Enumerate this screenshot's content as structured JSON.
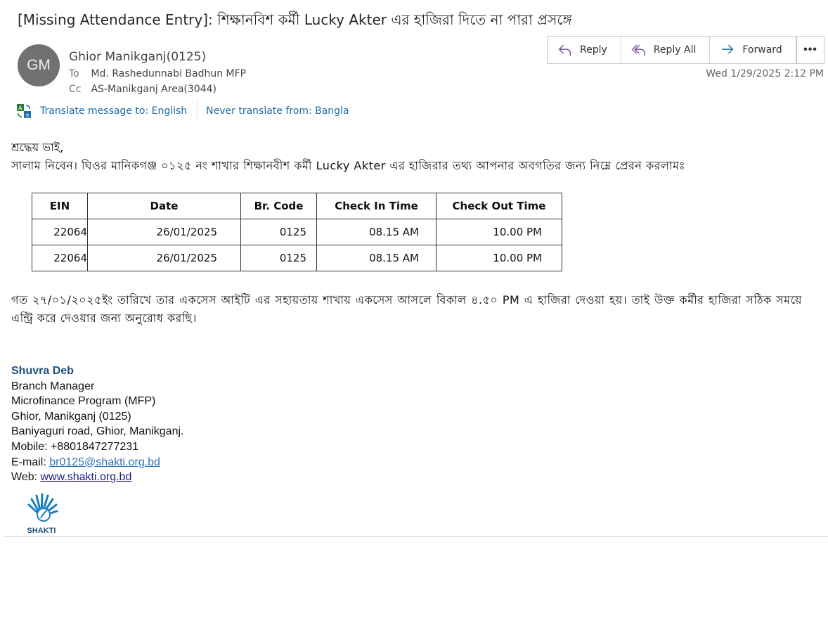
{
  "subject": "[Missing Attendance Entry]: শিক্ষানবিশ কর্মী Lucky Akter  এর হাজিরা দিতে না পারা প্রসঙ্গে",
  "avatar_initials": "GM",
  "sender": "Ghior Manikganj(0125)",
  "to_label": "To",
  "to_value": "Md. Rashedunnabi Badhun MFP",
  "cc_label": "Cc",
  "cc_value": "AS-Manikganj Area(3044)",
  "date": "Wed 1/29/2025 2:12 PM",
  "actions": {
    "reply": "Reply",
    "reply_all": "Reply All",
    "forward": "Forward",
    "more": "•••"
  },
  "translate": {
    "to": "Translate message to: English",
    "never": "Never translate from: Bangla"
  },
  "greeting": "শ্রদ্ধেয় ভাই,",
  "line1": "সালাম নিবেন। ঘিওর মানিকগঞ্জ ০১২৫ নং শাখার শিক্ষানবীশ কর্মী Lucky Akter এর হাজিরার তথ্য আপনার অবগতির জন্য নিম্নে প্রেরন করলামঃ",
  "table": {
    "headers": [
      "EIN",
      "Date",
      "Br. Code",
      "Check In Time",
      "Check Out Time"
    ],
    "rows": [
      [
        "22064",
        "26/01/2025",
        "0125",
        "08.15 AM",
        "10.00 PM"
      ],
      [
        "22064",
        "26/01/2025",
        "0125",
        "08.15 AM",
        "10.00 PM"
      ]
    ]
  },
  "para2": "গত ২৭/০১/২০২৫ইং তারিখে তার একসেস আইটি এর সহায়তায় শাখায় একসেস আসলে বিকাল ৪.৫০ PM এ হাজিরা দেওয়া হয়। তাই উক্ত কর্মীর হাজিরা সঠিক সময়ে এন্ট্রি করে দেওয়ার জন্য অনুরোধ করছি।",
  "signature": {
    "name": "Shuvra Deb",
    "title": "Branch Manager",
    "program": "Microfinance Program (MFP)",
    "branch": "Ghior, Manikganj (0125)",
    "address": "Baniyaguri road, Ghior, Manikganj.",
    "mobile": "Mobile: +8801847277231",
    "email_label": "E-mail: ",
    "email": "br0125@shakti.org.bd",
    "web_label": "Web: ",
    "web": "www.shakti.org.bd",
    "logo_text": "SHAKTI"
  },
  "colors": {
    "link": "#1a6aa8",
    "avatar": "#717171",
    "sig_name": "#1f4e79"
  }
}
